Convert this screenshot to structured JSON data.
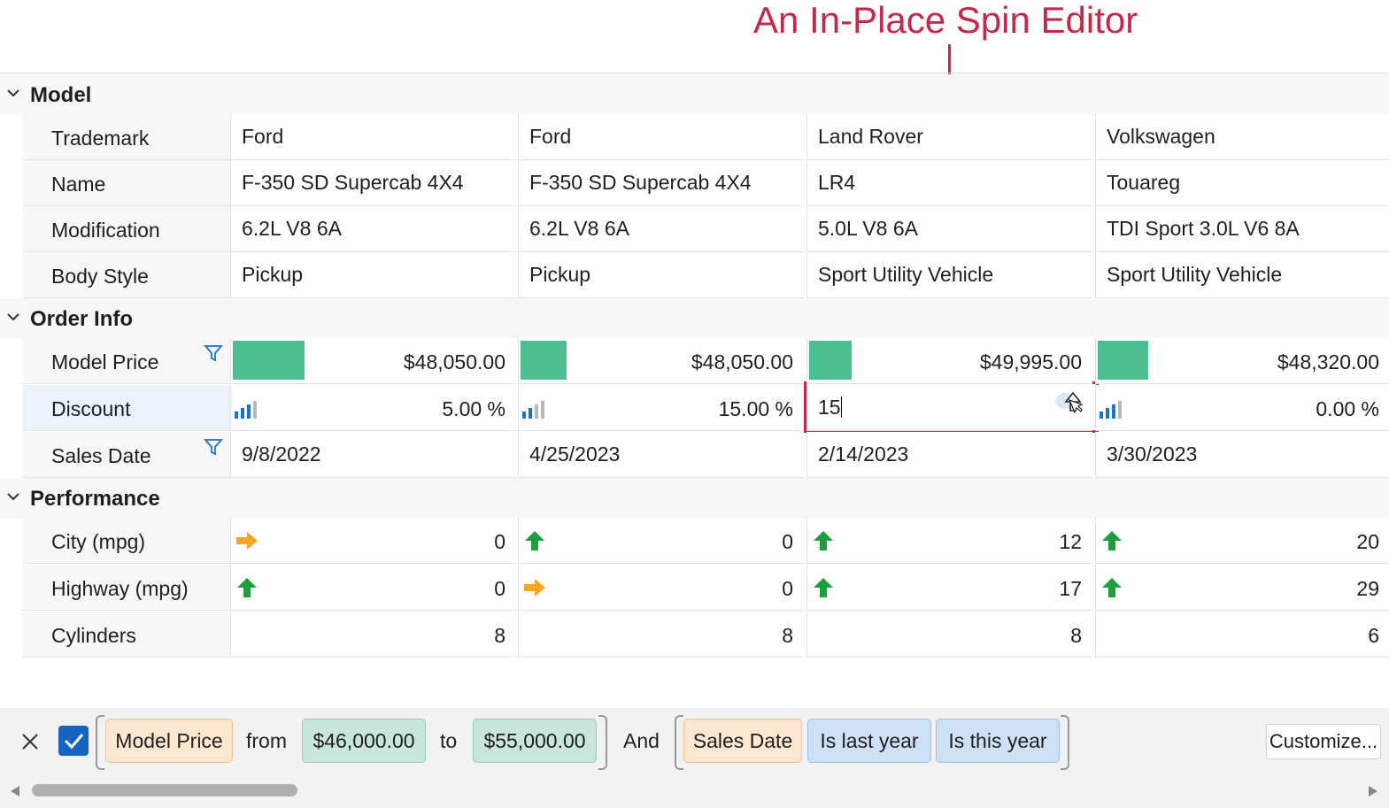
{
  "annotation": {
    "title": "An In-Place Spin Editor",
    "color": "#c4284b"
  },
  "categories": [
    {
      "label": "Model"
    },
    {
      "label": "Order Info"
    },
    {
      "label": "Performance"
    }
  ],
  "model_rows": [
    {
      "label": "Trademark",
      "values": [
        "Ford",
        "Ford",
        "Land Rover",
        "Volkswagen"
      ]
    },
    {
      "label": "Name",
      "values": [
        "F-350 SD Supercab 4X4",
        "F-350 SD Supercab 4X4",
        "LR4",
        "Touareg"
      ]
    },
    {
      "label": "Modification",
      "values": [
        "6.2L V8 6A",
        "6.2L V8 6A",
        "5.0L V8 6A",
        "TDI Sport 3.0L V6 8A"
      ]
    },
    {
      "label": "Body Style",
      "values": [
        "Pickup",
        "Pickup",
        "Sport Utility Vehicle",
        "Sport Utility Vehicle"
      ]
    }
  ],
  "order_rows": {
    "model_price": {
      "label": "Model Price",
      "values": [
        "$48,050.00",
        "$48,050.00",
        "$49,995.00",
        "$48,320.00"
      ],
      "bar_fractions": [
        0.25,
        0.16,
        0.15,
        0.17
      ]
    },
    "discount": {
      "label": "Discount",
      "values": [
        "5.00 %",
        "15.00 %",
        "",
        "0.00 %"
      ],
      "editor_value": "15"
    },
    "sales_date": {
      "label": "Sales Date",
      "values": [
        "9/8/2022",
        "4/25/2023",
        "2/14/2023",
        "3/30/2023"
      ]
    }
  },
  "performance_rows": [
    {
      "label": "City (mpg)",
      "values": [
        "0",
        "0",
        "12",
        "20"
      ],
      "icons": [
        "arrow-right-icon",
        "arrow-up-icon",
        "arrow-up-icon",
        "arrow-up-icon"
      ]
    },
    {
      "label": "Highway (mpg)",
      "values": [
        "0",
        "0",
        "17",
        "29"
      ],
      "icons": [
        "arrow-up-icon",
        "arrow-right-icon",
        "arrow-up-icon",
        "arrow-up-icon"
      ]
    },
    {
      "label": "Cylinders",
      "values": [
        "8",
        "8",
        "8",
        "6"
      ]
    }
  ],
  "filter_panel": {
    "field1": "Model Price",
    "from_label": "from",
    "from_value": "$46,000.00",
    "to_label": "to",
    "to_value": "$55,000.00",
    "and_label": "And",
    "field2": "Sales Date",
    "op1": "Is last year",
    "op2": "Is this year",
    "customize_label": "Customize..."
  },
  "colors": {
    "bar": "#4dc08f",
    "arrow_up": "#1e9e3e",
    "arrow_right": "#f5a623",
    "filter_icon": "#1a73c9",
    "signal": "#1a73c9"
  }
}
